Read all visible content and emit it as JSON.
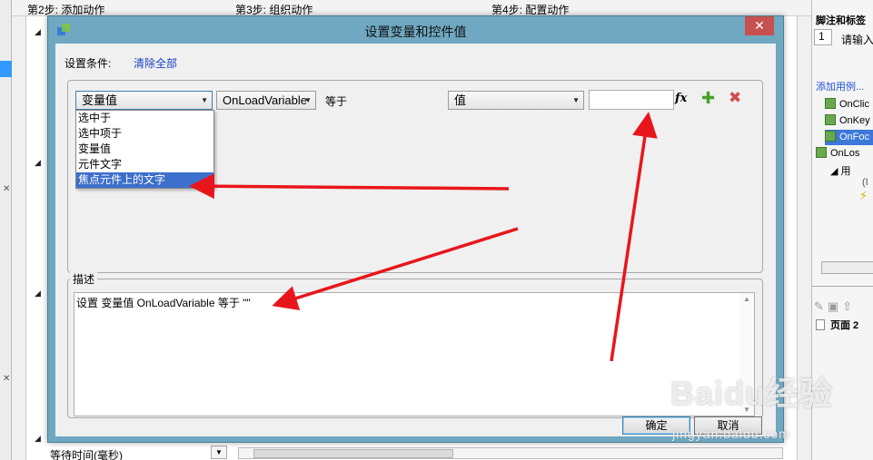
{
  "background": {
    "steps": [
      "第2步: 添加动作",
      "第3步: 组织动作",
      "第4步: 配置动作"
    ],
    "wait_label": "等待时间(毫秒)",
    "right_panel": {
      "title": "脚注和标签",
      "number_value": "1",
      "input_hint": "请输入",
      "add_case_link": "添加用例...",
      "events": [
        "OnClic",
        "OnKey",
        "OnFoc",
        "OnLos"
      ],
      "case_label": "用",
      "case_sub": "(I",
      "page_label": "页面 2"
    }
  },
  "dialog": {
    "title": "设置变量和控件值",
    "close_glyph": "✕",
    "condition_label": "设置条件:",
    "clear_all_link": "清除全部",
    "condition": {
      "variable_type": "变量值",
      "variable_name": "OnLoadVariable",
      "operator": "等于",
      "value_type": "值",
      "value_input": ""
    },
    "dropdown_options": [
      "选中于",
      "选中项于",
      "变量值",
      "元件文字",
      "焦点元件上的文字"
    ],
    "highlighted_option_index": 4,
    "description_label": "描述",
    "description_text": "设置 变量值 OnLoadVariable 等于 \"\"",
    "ok_button": "确定",
    "cancel_button": "取消"
  },
  "watermark": {
    "brand": "Baidu经验",
    "url": "jingyan.baidu.com"
  },
  "colors": {
    "dialog_frame": "#6fa8c0",
    "close_button": "#c75050",
    "highlight": "#3d6fcc",
    "link": "#1a3fc4",
    "annotation_arrow": "#e8161b"
  }
}
